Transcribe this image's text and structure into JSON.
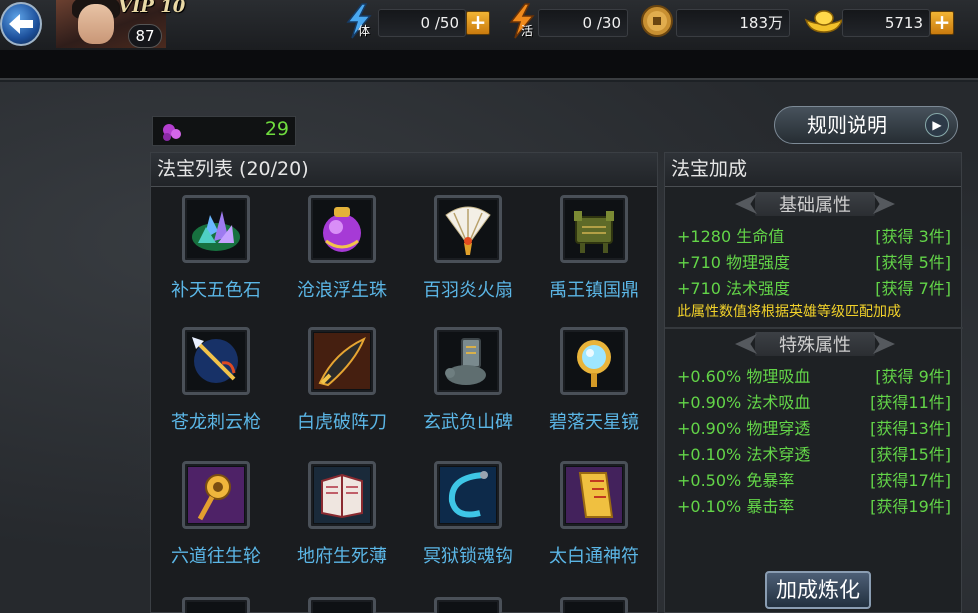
{
  "topbar": {
    "vip_label": "VIP 10",
    "player_level": "87",
    "stamina": {
      "value": "0 /50",
      "unit_char": "体"
    },
    "vigor": {
      "value": "0 /30",
      "unit_char": "活"
    },
    "copper": {
      "value": "183万"
    },
    "gold": {
      "value": "5713"
    },
    "plus_symbol": "+"
  },
  "gem_count": "29",
  "rules_button": "规则说明",
  "list_panel": {
    "title": "法宝列表 (20/20)",
    "items": [
      {
        "name": "补天五色石",
        "icon": "crystal-icon"
      },
      {
        "name": "沧浪浮生珠",
        "icon": "orb-icon"
      },
      {
        "name": "百羽炎火扇",
        "icon": "fan-icon"
      },
      {
        "name": "禹王镇国鼎",
        "icon": "cauldron-icon"
      },
      {
        "name": "苍龙刺云枪",
        "icon": "spear-icon"
      },
      {
        "name": "白虎破阵刀",
        "icon": "blade-icon"
      },
      {
        "name": "玄武负山碑",
        "icon": "tortoise-stele-icon"
      },
      {
        "name": "碧落天星镜",
        "icon": "mirror-icon"
      },
      {
        "name": "六道往生轮",
        "icon": "wheel-icon"
      },
      {
        "name": "地府生死薄",
        "icon": "book-icon"
      },
      {
        "name": "冥狱锁魂钩",
        "icon": "hook-icon"
      },
      {
        "name": "太白通神符",
        "icon": "talisman-icon"
      }
    ]
  },
  "bonus_panel": {
    "title": "法宝加成",
    "basic_title": "基础属性",
    "basic_stats": [
      {
        "text": "+1280 生命值",
        "requirement": "[获得 3件]"
      },
      {
        "text": "+710 物理强度",
        "requirement": "[获得 5件]"
      },
      {
        "text": "+710 法术强度",
        "requirement": "[获得 7件]"
      }
    ],
    "note": "此属性数值将根据英雄等级匹配加成",
    "special_title": "特殊属性",
    "special_stats": [
      {
        "text": "+0.60% 物理吸血",
        "requirement": "[获得 9件]"
      },
      {
        "text": "+0.90% 法术吸血",
        "requirement": "[获得11件]"
      },
      {
        "text": "+0.90% 物理穿透",
        "requirement": "[获得13件]"
      },
      {
        "text": "+0.10% 法术穿透",
        "requirement": "[获得15件]"
      },
      {
        "text": "+0.50% 免暴率",
        "requirement": "[获得17件]"
      },
      {
        "text": "+0.10% 暴击率",
        "requirement": "[获得19件]"
      }
    ],
    "refine_button": "加成炼化"
  }
}
